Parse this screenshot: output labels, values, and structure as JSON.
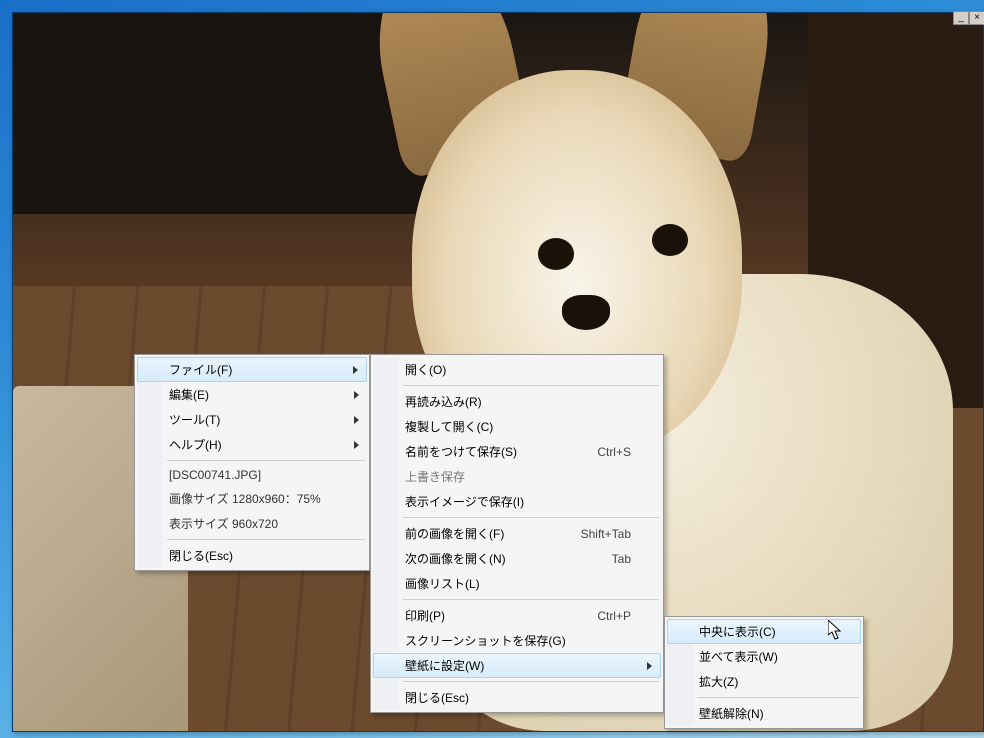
{
  "window": {
    "minimize_glyph": "_",
    "close_glyph": "×"
  },
  "menu1": {
    "file": "ファイル(F)",
    "edit": "編集(E)",
    "tool": "ツール(T)",
    "help": "ヘルプ(H)",
    "filename": "[DSC00741.JPG]",
    "image_size": "画像サイズ 1280x960：75%",
    "display_size": "表示サイズ 960x720",
    "close": "閉じる(Esc)"
  },
  "menu2": {
    "open": "開く(O)",
    "reload": "再読み込み(R)",
    "open_copy": "複製して開く(C)",
    "save_as": "名前をつけて保存(S)",
    "save_as_sc": "Ctrl+S",
    "overwrite": "上書き保存",
    "save_view_image": "表示イメージで保存(I)",
    "prev_image": "前の画像を開く(F)",
    "prev_image_sc": "Shift+Tab",
    "next_image": "次の画像を開く(N)",
    "next_image_sc": "Tab",
    "image_list": "画像リスト(L)",
    "print": "印刷(P)",
    "print_sc": "Ctrl+P",
    "save_screenshot": "スクリーンショットを保存(G)",
    "set_wallpaper": "壁紙に設定(W)",
    "close": "閉じる(Esc)"
  },
  "menu3": {
    "center": "中央に表示(C)",
    "tile": "並べて表示(W)",
    "stretch": "拡大(Z)",
    "remove": "壁紙解除(N)"
  }
}
